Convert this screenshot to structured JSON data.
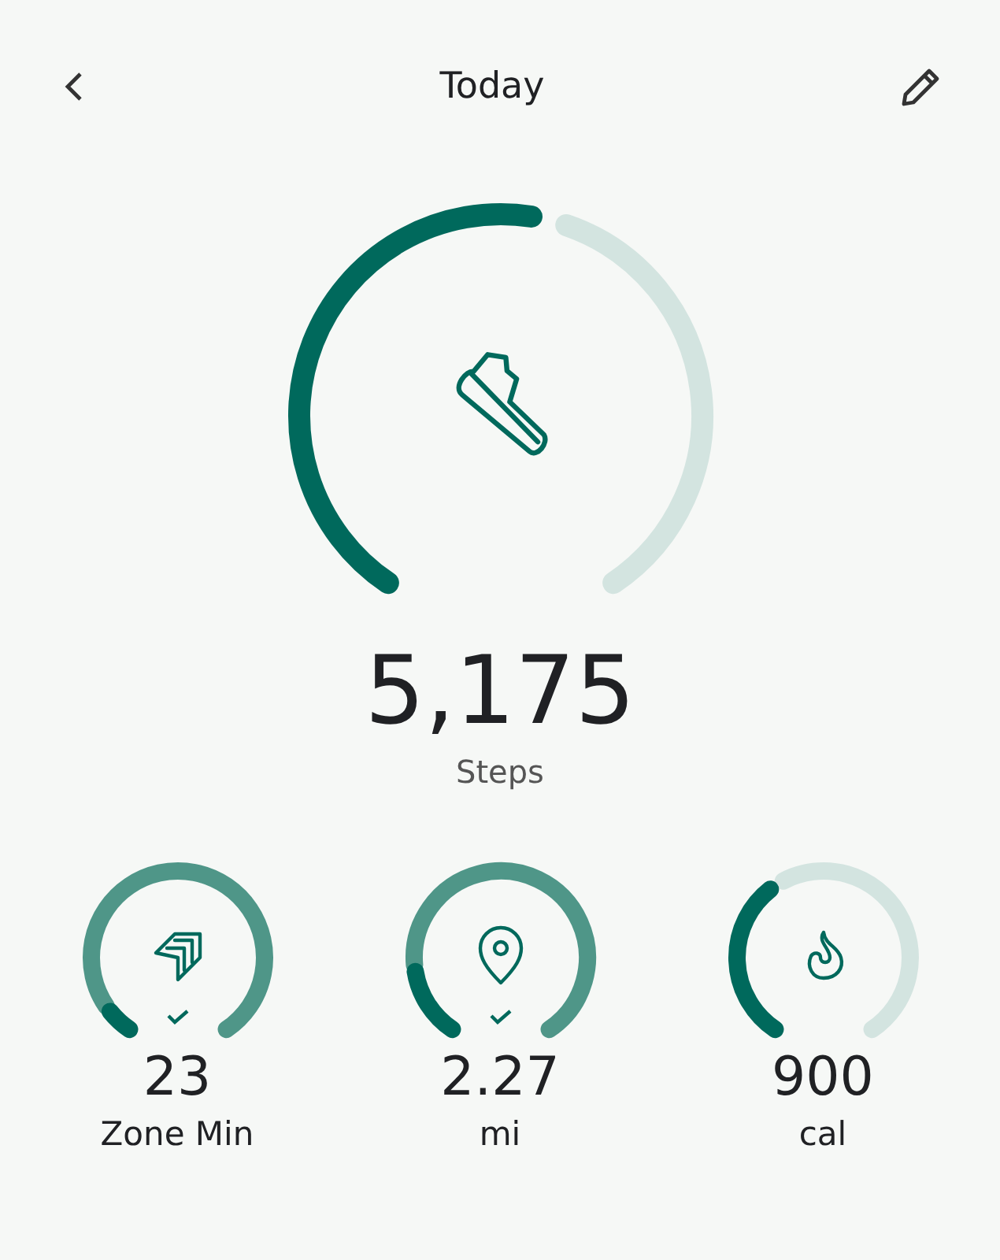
{
  "header": {
    "title": "Today"
  },
  "main": {
    "value": "5,175",
    "label": "Steps"
  },
  "rings": [
    {
      "kind": "zone",
      "goal_met": true,
      "value": "23",
      "label": "Zone Min"
    },
    {
      "kind": "distance",
      "goal_met": true,
      "value": "2.27",
      "label": "mi"
    },
    {
      "kind": "calories",
      "goal_met": false,
      "value": "900",
      "label": "cal"
    }
  ]
}
